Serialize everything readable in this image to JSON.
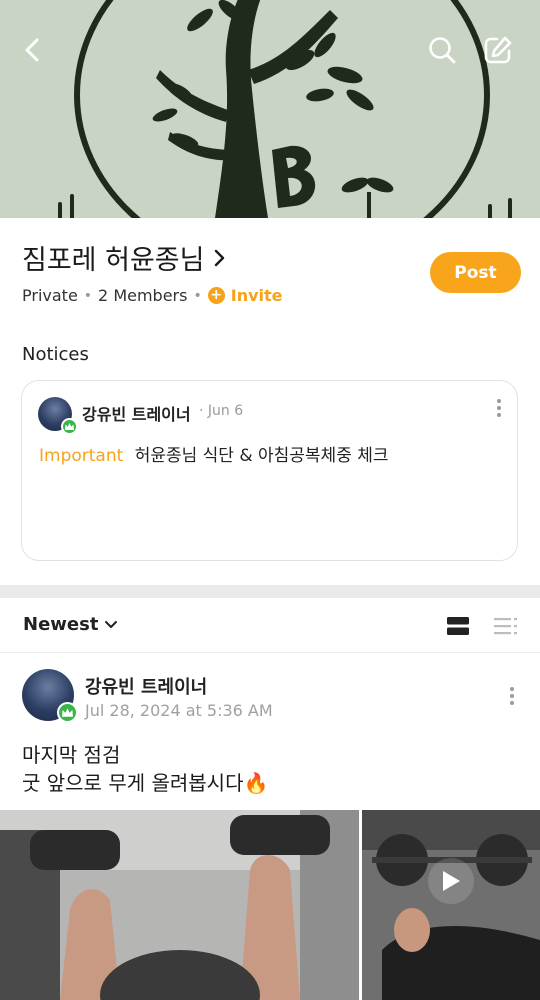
{
  "cover": {
    "description_icons": [
      "back-icon",
      "search-icon",
      "compose-icon"
    ]
  },
  "header": {
    "title": "짐포레 허윤종님",
    "privacy": "Private",
    "members": "2 Members",
    "invite_label": "Invite",
    "post_label": "Post"
  },
  "notices": {
    "label": "Notices",
    "items": [
      {
        "author": "강유빈 트레이너",
        "date": "· Jun 6",
        "tag": "Important",
        "text": "허윤종님 식단 & 아침공복체중 체크"
      }
    ]
  },
  "feed": {
    "sort_label": "Newest",
    "posts": [
      {
        "author": "강유빈 트레이너",
        "date": "Jul 28, 2024 at 5:36 AM",
        "lines": [
          "마지막 점검",
          "굿 앞으로 무게 올려봅시다🔥"
        ],
        "media_count": 2
      }
    ]
  },
  "colors": {
    "accent": "#f8a51c",
    "cover_bg": "#c9d4c5",
    "badge": "#39b54a"
  }
}
